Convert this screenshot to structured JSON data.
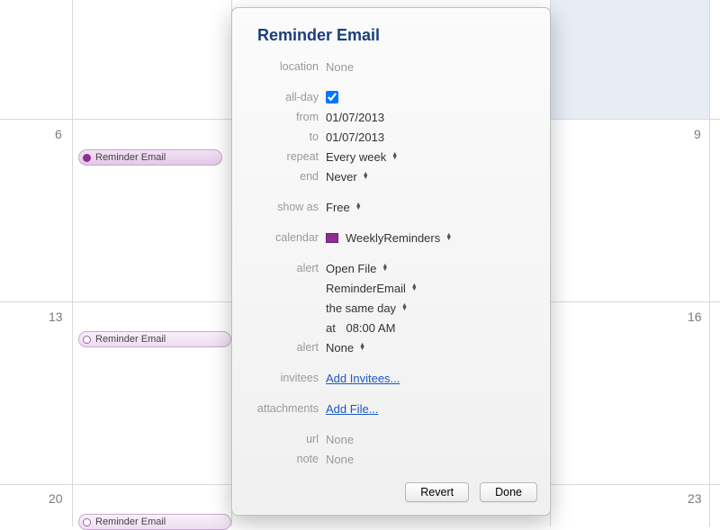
{
  "calendar_bg": {
    "days": {
      "n6": "6",
      "n9": "9",
      "n13": "13",
      "n16": "16",
      "n20": "20",
      "n23": "23"
    },
    "event_title": "Reminder Email"
  },
  "popover": {
    "title": "Reminder Email",
    "labels": {
      "location": "location",
      "allday": "all-day",
      "from": "from",
      "to": "to",
      "repeat": "repeat",
      "end": "end",
      "showas": "show as",
      "calendar": "calendar",
      "alert": "alert",
      "alert2": "alert",
      "at": "at",
      "invitees": "invitees",
      "attachments": "attachments",
      "url": "url",
      "note": "note"
    },
    "values": {
      "location": "None",
      "allday_checked": true,
      "from": "01/07/2013",
      "to": "01/07/2013",
      "repeat": "Every week",
      "end": "Never",
      "showas": "Free",
      "calendar_name": "WeeklyReminders",
      "calendar_color": "#8e2e93",
      "alert_type": "Open File",
      "alert_file": "ReminderEmail",
      "alert_when": "the same day",
      "alert_time": "08:00 AM",
      "alert2": "None",
      "invitees_link": "Add Invitees...",
      "attachments_link": "Add File...",
      "url": "None",
      "note": "None"
    },
    "buttons": {
      "revert": "Revert",
      "done": "Done"
    }
  }
}
